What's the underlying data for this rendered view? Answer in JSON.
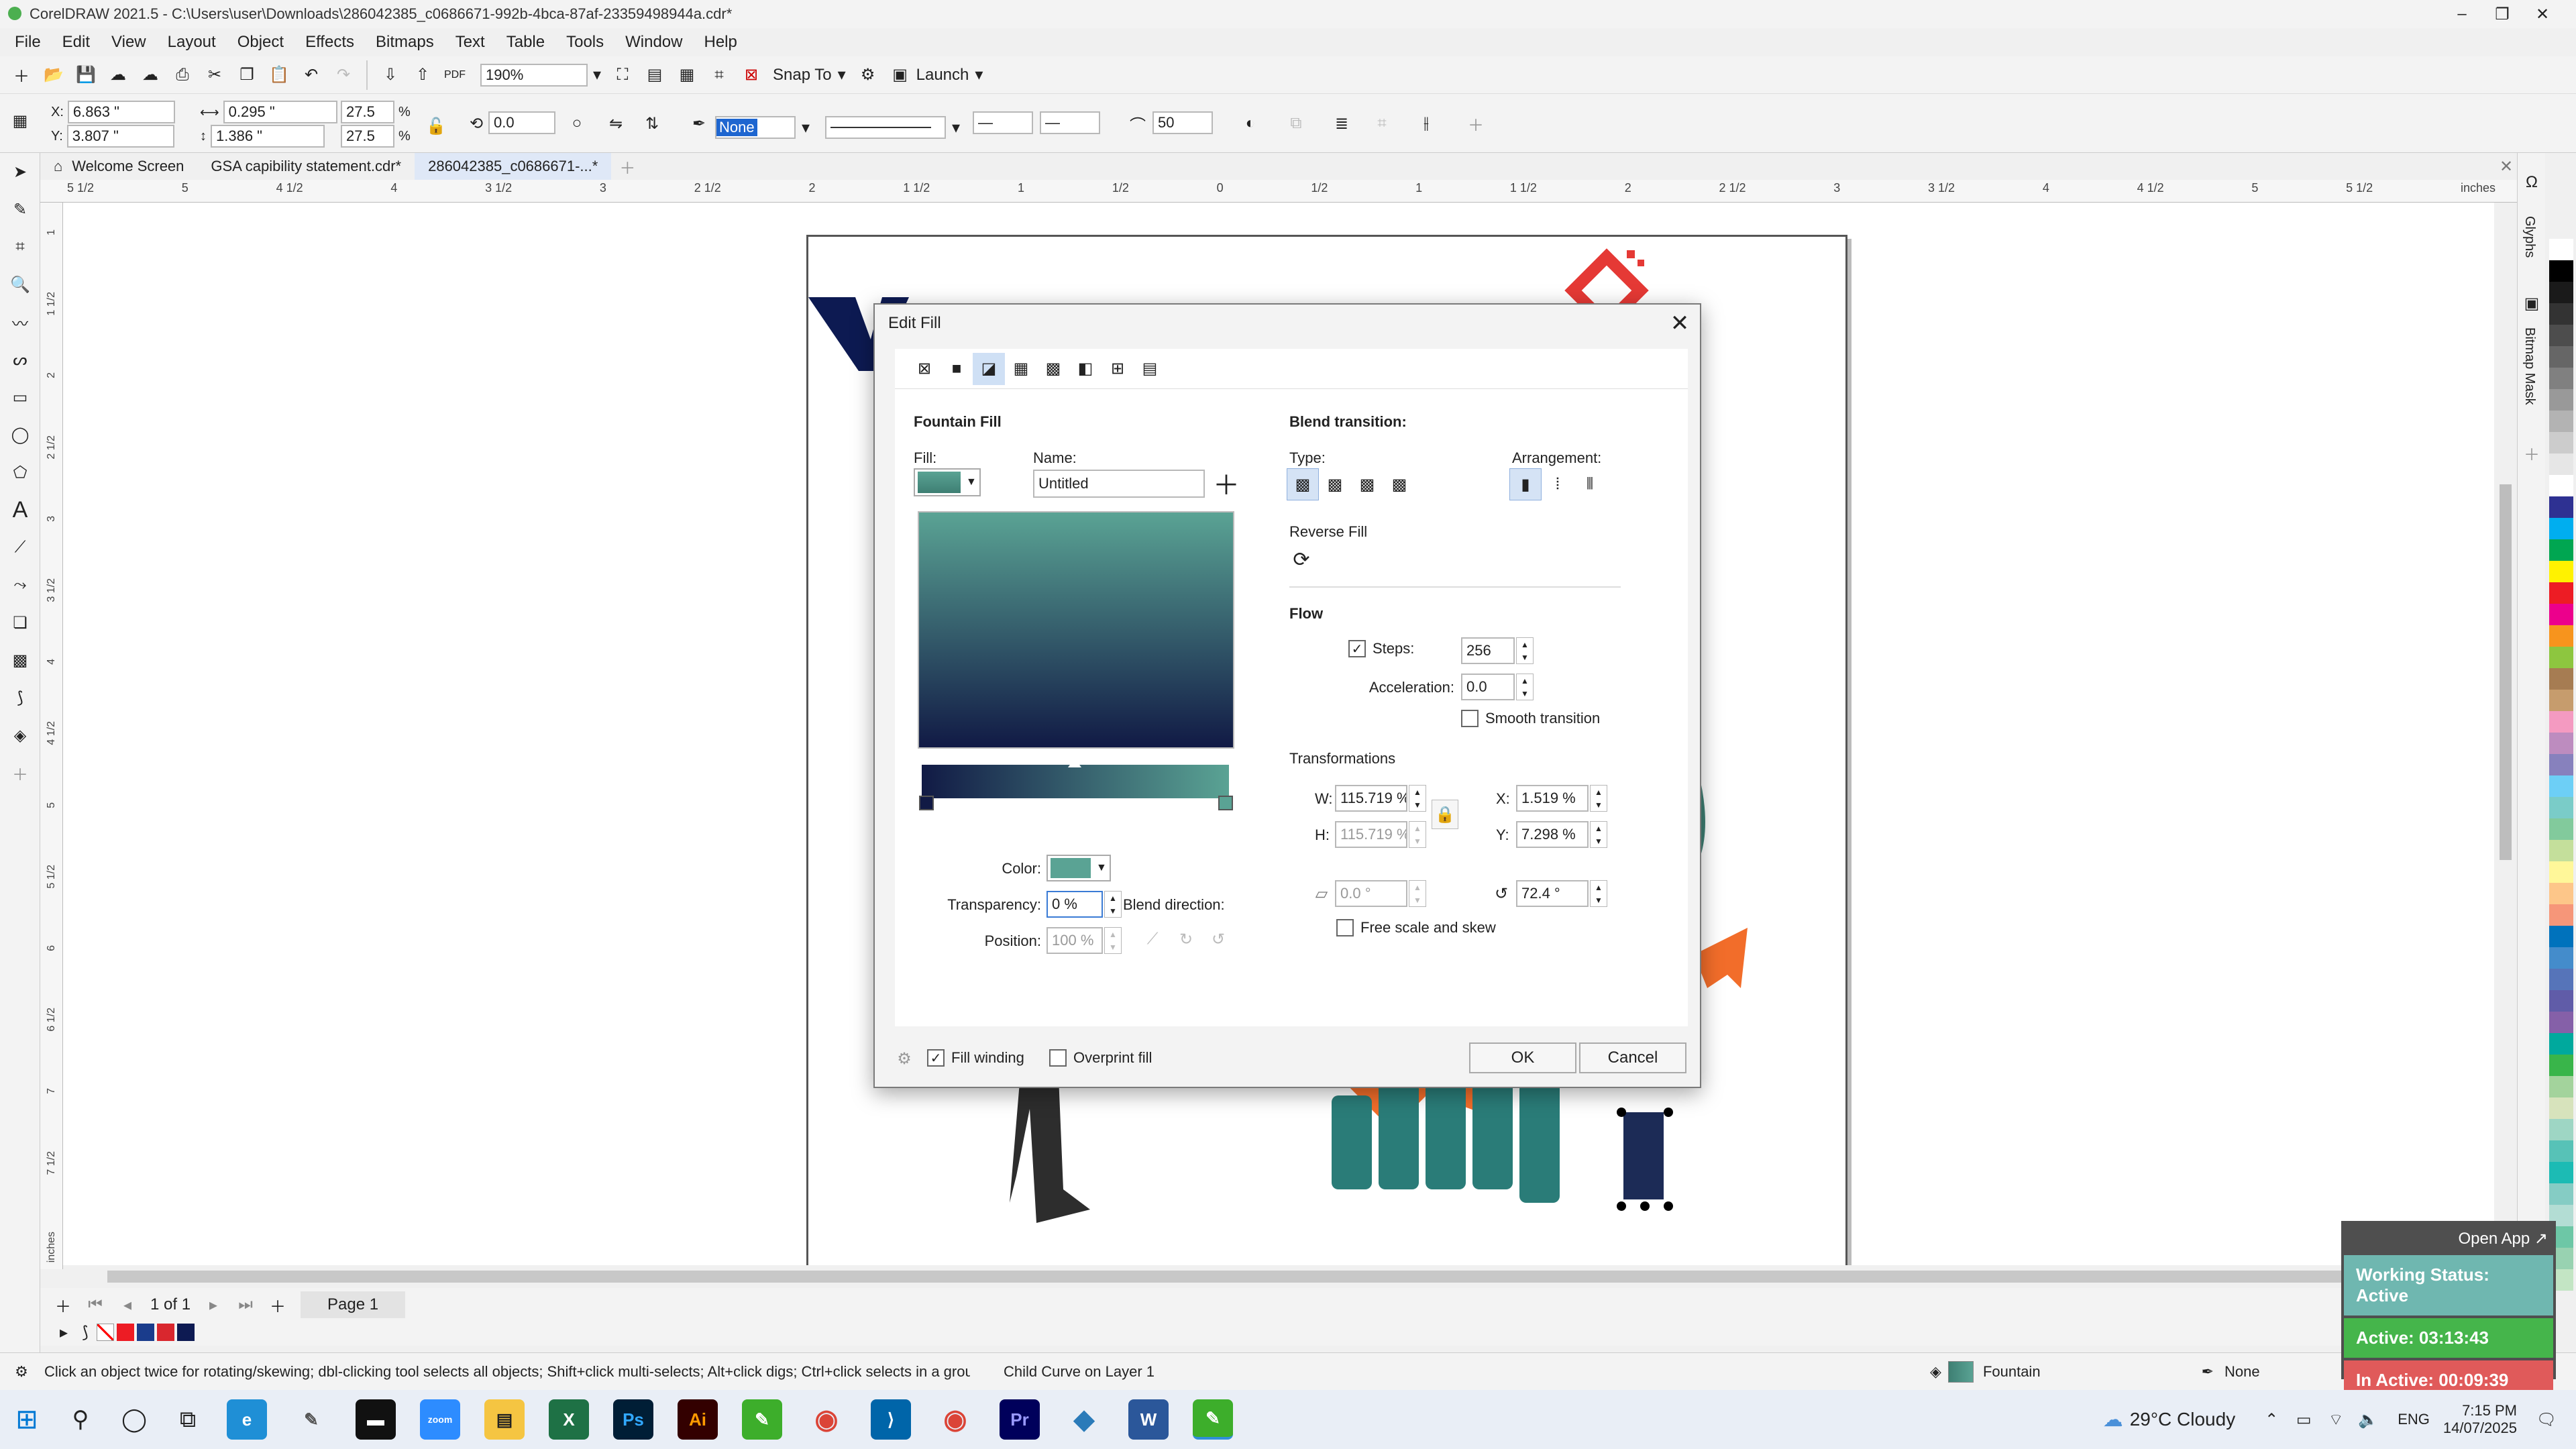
{
  "window": {
    "title": "CorelDRAW 2021.5 - C:\\Users\\user\\Downloads\\286042385_c0686671-992b-4bca-87af-23359498944a.cdr*"
  },
  "menu": [
    "File",
    "Edit",
    "View",
    "Layout",
    "Object",
    "Effects",
    "Bitmaps",
    "Text",
    "Table",
    "Tools",
    "Window",
    "Help"
  ],
  "toolbar": {
    "zoom": "190%",
    "snap_to": "Snap To",
    "launch": "Launch"
  },
  "propbar": {
    "x": "6.863 \"",
    "y": "3.807 \"",
    "w": "0.295 \"",
    "h": "1.386 \"",
    "sx": "27.5",
    "sy": "27.5",
    "pct": "%",
    "angle": "0.0",
    "outline": "None",
    "size": "50"
  },
  "tabs": [
    "Welcome Screen",
    "GSA  capibility statement.cdr*",
    "286042385_c0686671-...*"
  ],
  "ruler_h": [
    "5 1/2",
    "5",
    "4 1/2",
    "4",
    "3 1/2",
    "3",
    "2 1/2",
    "2",
    "1 1/2",
    "1",
    "1/2",
    "0",
    "1/2",
    "1",
    "1 1/2",
    "2",
    "2 1/2",
    "3",
    "3 1/2",
    "4",
    "4 1/2",
    "5",
    "5 1/2",
    "inches"
  ],
  "ruler_v": [
    "1",
    "1 1/2",
    "2",
    "2 1/2",
    "3",
    "3 1/2",
    "4",
    "4 1/2",
    "5",
    "5 1/2",
    "6",
    "6 1/2",
    "7",
    "7 1/2",
    "inches"
  ],
  "dialog": {
    "title": "Edit Fill",
    "section_title": "Fountain Fill",
    "fill_label": "Fill:",
    "name_label": "Name:",
    "name_value": "Untitled",
    "color_label": "Color:",
    "transparency_label": "Transparency:",
    "transparency_value": "0 %",
    "position_label": "Position:",
    "position_value": "100 %",
    "blend_direction_label": "Blend direction:",
    "blend_transition_label": "Blend transition:",
    "type_label": "Type:",
    "arrangement_label": "Arrangement:",
    "reverse_fill_label": "Reverse Fill",
    "flow_label": "Flow",
    "steps_label": "Steps:",
    "steps_value": "256",
    "acceleration_label": "Acceleration:",
    "acceleration_value": "0.0",
    "smooth_label": "Smooth transition",
    "transformations_label": "Transformations",
    "w_label": "W:",
    "w_value": "115.719 %",
    "h_label": "H:",
    "h_value": "115.719 %",
    "x_label": "X:",
    "x_value": "1.519 %",
    "y_label": "Y:",
    "y_value": "7.298 %",
    "skew_value": "0.0 °",
    "rotate_value": "72.4 °",
    "free_scale_label": "Free scale and skew",
    "fill_winding_label": "Fill winding",
    "overprint_label": "Overprint fill",
    "ok": "OK",
    "cancel": "Cancel",
    "gradient_start": "#5aa394",
    "gradient_end": "#111a45"
  },
  "pagenav": {
    "count": "1 of 1",
    "page": "Page 1"
  },
  "status": {
    "hint": "Click an object twice for rotating/skewing; dbl-clicking tool selects all objects; Shift+click multi-selects; Alt+click digs; Ctrl+click selects in a group",
    "info": "Child Curve on Layer 1",
    "fill": "Fountain",
    "outline": "None"
  },
  "widget": {
    "open_app": "Open App ↗",
    "working": "Working Status: Active",
    "active": "Active: 03:13:43",
    "inactive": "In Active: 00:09:39"
  },
  "dockers": [
    "Glyphs",
    "Bitmap Mask"
  ],
  "taskbar": {
    "weather": "29°C  Cloudy",
    "lang": "ENG",
    "time": "7:15 PM",
    "date": "14/07/2025"
  },
  "palette": [
    "#ffffff",
    "#000000",
    "#1a1a1a",
    "#333333",
    "#4d4d4d",
    "#666666",
    "#808080",
    "#999999",
    "#b3b3b3",
    "#cccccc",
    "#e6e6e6",
    "#ffffff",
    "#2e3192",
    "#00aeef",
    "#00a651",
    "#fff200",
    "#ed1c24",
    "#ec008c",
    "#f7941d",
    "#8dc63f",
    "#a67c52",
    "#c69c6d",
    "#f49ac1",
    "#bd8cbf",
    "#8781bd",
    "#6dcff6",
    "#7accc8",
    "#82ca9c",
    "#c4df9b",
    "#fff799",
    "#fdc689",
    "#f69679",
    "#0072bc",
    "#448ccb",
    "#5674b9",
    "#605ca8",
    "#8560a8",
    "#00a99d",
    "#39b54a",
    "#a3d39c",
    "#d7e3bc",
    "#9ed6c4",
    "#57c2b7",
    "#1cbbb4",
    "#85ccc4",
    "#b3ddd4",
    "#6dc7a6",
    "#98d2b1",
    "#c3e5c4"
  ]
}
